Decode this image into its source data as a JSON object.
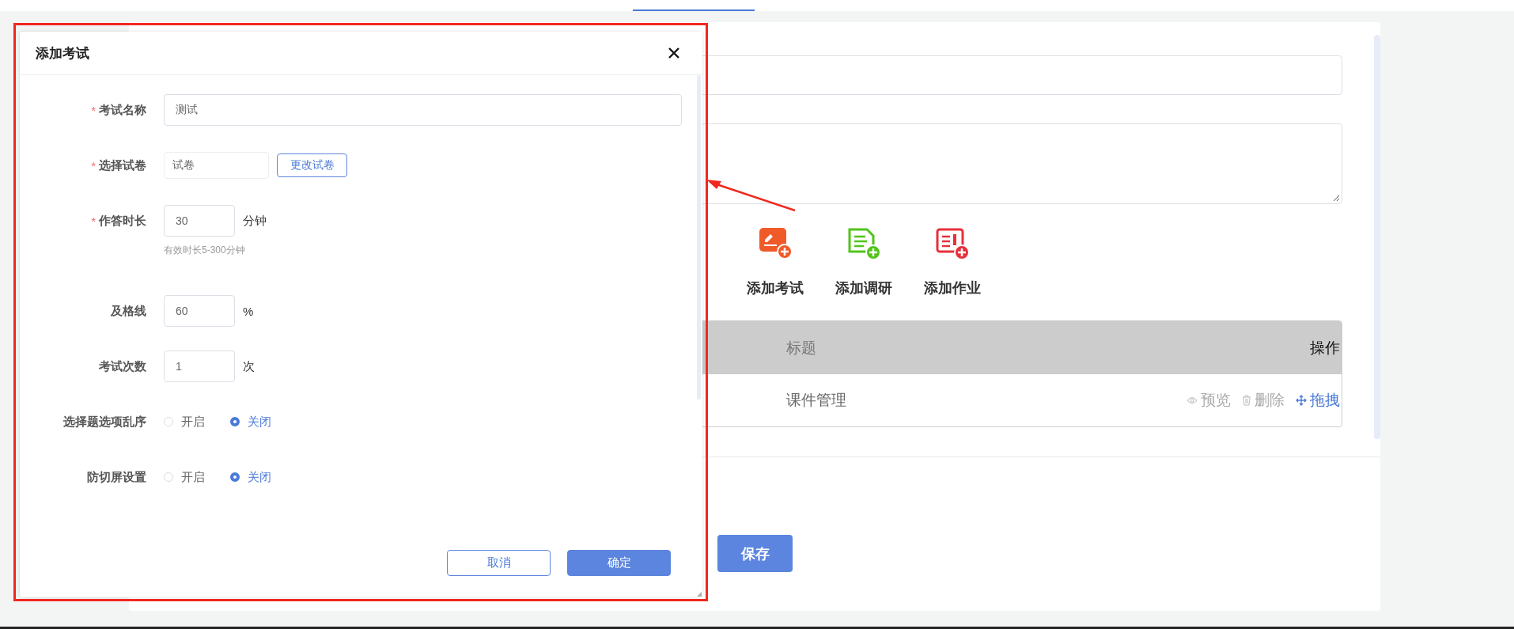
{
  "dialog": {
    "title": "添加考试",
    "fields": [
      {
        "kind": "text",
        "required_mark": "*",
        "label": "考试名称",
        "value": "测试"
      },
      {
        "kind": "paper",
        "required_mark": "*",
        "label": "选择试卷",
        "value": "试卷",
        "button": "更改试卷"
      },
      {
        "kind": "number",
        "required_mark": "*",
        "label": "作答时长",
        "value": "30",
        "unit": "分钟",
        "hint": "有效时长5-300分钟"
      },
      {
        "kind": "number",
        "label": "及格线",
        "value": "60",
        "unit": "%"
      },
      {
        "kind": "number",
        "label": "考试次数",
        "value": "1",
        "unit": "次"
      },
      {
        "kind": "radio",
        "label": "选择题选项乱序",
        "options": [
          {
            "label": "开启",
            "selected": false
          },
          {
            "label": "关闭",
            "selected": true
          }
        ]
      },
      {
        "kind": "radio",
        "label": "防切屏设置",
        "options": [
          {
            "label": "开启",
            "selected": false
          },
          {
            "label": "关闭",
            "selected": true
          }
        ]
      }
    ],
    "buttons": [
      {
        "label": "取消",
        "kind": "secondary"
      },
      {
        "label": "确定",
        "kind": "primary"
      }
    ]
  },
  "add_actions": [
    {
      "label": "添加考试",
      "kind": "exam"
    },
    {
      "label": "添加调研",
      "kind": "survey"
    },
    {
      "label": "添加作业",
      "kind": "homework"
    }
  ],
  "table": {
    "columns": [
      "标题",
      "操作"
    ],
    "rows": [
      {
        "title": "课件管理",
        "actions": [
          {
            "label": "预览",
            "kind": "preview"
          },
          {
            "label": "删除",
            "kind": "delete"
          },
          {
            "label": "拖拽",
            "kind": "drag"
          }
        ]
      }
    ]
  },
  "save_button": "保存"
}
